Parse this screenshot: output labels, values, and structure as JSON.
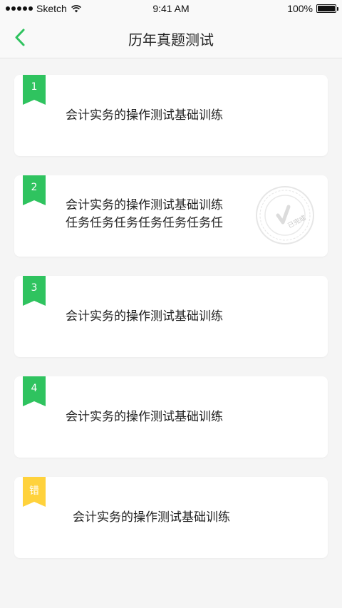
{
  "status_bar": {
    "carrier": "Sketch",
    "time": "9:41 AM",
    "battery": "100%"
  },
  "nav": {
    "title": "历年真题测试",
    "back_icon": "chevron-left-icon"
  },
  "colors": {
    "accent": "#2fc35f",
    "warning": "#ffd23c",
    "background": "#f5f5f5"
  },
  "items": [
    {
      "badge": "1",
      "line1": "会计实务的操作测试基础训练",
      "line2": ""
    },
    {
      "badge": "2",
      "line1": "会计实务的操作测试基础训练",
      "line2": "任务任务任务任务任务任务任",
      "stamp": "已完成"
    },
    {
      "badge": "3",
      "line1": "会计实务的操作测试基础训练",
      "line2": ""
    },
    {
      "badge": "4",
      "line1": "会计实务的操作测试基础训练",
      "line2": ""
    },
    {
      "badge": "错",
      "line1": "会计实务的操作测试基础训练",
      "line2": ""
    }
  ]
}
